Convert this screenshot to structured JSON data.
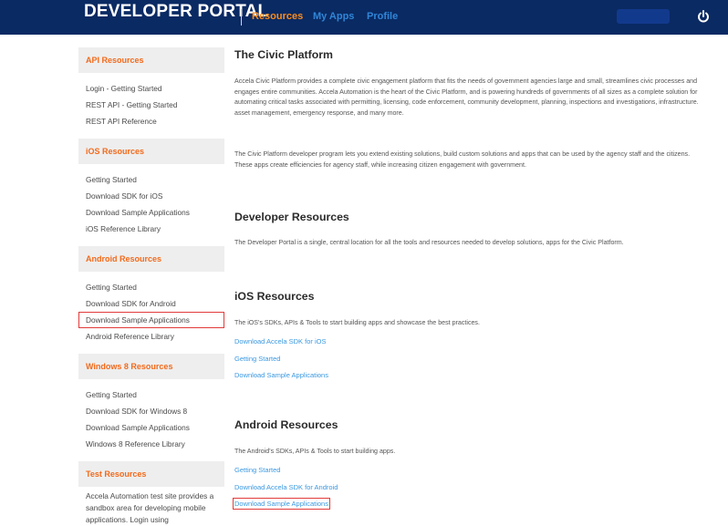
{
  "header": {
    "brand": "DEVELOPER PORTAL",
    "nav": [
      {
        "label": "Resources",
        "active": true
      },
      {
        "label": "My Apps",
        "active": false
      },
      {
        "label": "Profile",
        "active": false
      }
    ],
    "colors": {
      "bar": "#0a2a63",
      "active": "#ff8c1a",
      "link": "#2f86d8"
    }
  },
  "sidebar": {
    "sections": [
      {
        "title": "API Resources",
        "items": [
          "Login - Getting Started",
          "REST API - Getting Started",
          "REST API Reference"
        ]
      },
      {
        "title": "iOS Resources",
        "items": [
          "Getting Started",
          "Download SDK for iOS",
          "Download Sample Applications",
          "iOS Reference Library"
        ]
      },
      {
        "title": "Android Resources",
        "items": [
          "Getting Started",
          "Download SDK for Android",
          "Download Sample Applications",
          "Android Reference Library"
        ]
      },
      {
        "title": "Windows 8 Resources",
        "items": [
          "Getting Started",
          "Download SDK for Windows 8",
          "Download Sample Applications",
          "Windows 8 Reference Library"
        ]
      },
      {
        "title": "Test Resources",
        "text": "Accela Automation test site provides a sandbox area for developing mobile applications. Login using"
      }
    ]
  },
  "main": {
    "civic": {
      "title": "The Civic Platform",
      "p1": "Accela Civic Platform provides a complete civic engagement platform that fits the needs of government agencies large and small, streamlines civic processes and engages entire communities. Accela Automation is the heart of the Civic Platform, and is powering hundreds of governments of all sizes as a complete solution for automating critical tasks associated with permitting, licensing, code enforcement, community development, planning, inspections and investigations, infrastructure. asset management, emergency response, and many more.",
      "p2": "The Civic Platform developer program lets you extend existing solutions, build custom solutions and apps that can be used by the agency staff and the citizens. These apps create efficiencies for agency staff, while increasing citizen engagement with government."
    },
    "developer": {
      "title": "Developer Resources",
      "p": "The Developer Portal is a single, central location for all the tools and resources needed to develop solutions, apps for the Civic Platform."
    },
    "ios": {
      "title": "iOS Resources",
      "p": "The iOS's SDKs, APIs & Tools to start building apps and showcase the best practices.",
      "links": [
        "Download Accela SDK for iOS",
        "Getting Started",
        "Download Sample Applications"
      ]
    },
    "android": {
      "title": "Android Resources",
      "p": "The Android's SDKs, APIs & Tools to start building apps.",
      "links": [
        "Getting Started",
        "Download Accela SDK for Android",
        "Download Sample Applications"
      ]
    }
  }
}
